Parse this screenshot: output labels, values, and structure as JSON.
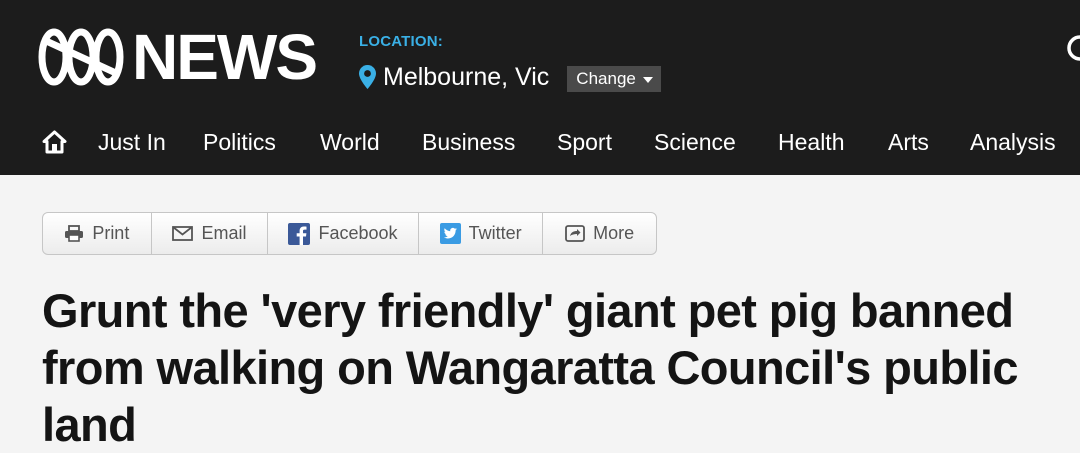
{
  "header": {
    "brand": "NEWS",
    "location_label": "LOCATION:",
    "location_value": "Melbourne, Vic",
    "change_label": "Change",
    "icons": {
      "logo": "abc-logo",
      "pin": "map-pin-icon",
      "search": "search-icon"
    },
    "colors": {
      "background": "#1c1c1c",
      "accent": "#3ab0e6",
      "text": "#ffffff"
    }
  },
  "nav": {
    "home_icon": "home-icon",
    "items": [
      {
        "label": "Just In"
      },
      {
        "label": "Politics"
      },
      {
        "label": "World"
      },
      {
        "label": "Business"
      },
      {
        "label": "Sport"
      },
      {
        "label": "Science"
      },
      {
        "label": "Health"
      },
      {
        "label": "Arts"
      },
      {
        "label": "Analysis"
      }
    ]
  },
  "share": {
    "items": [
      {
        "label": "Print",
        "icon": "printer-icon"
      },
      {
        "label": "Email",
        "icon": "envelope-icon"
      },
      {
        "label": "Facebook",
        "icon": "facebook-icon",
        "color": "#3b5998"
      },
      {
        "label": "Twitter",
        "icon": "twitter-icon",
        "color": "#3a9be3"
      },
      {
        "label": "More",
        "icon": "share-more-icon"
      }
    ]
  },
  "article": {
    "headline": "Grunt the 'very friendly' giant pet pig banned from walking on Wangaratta Council's public land"
  }
}
